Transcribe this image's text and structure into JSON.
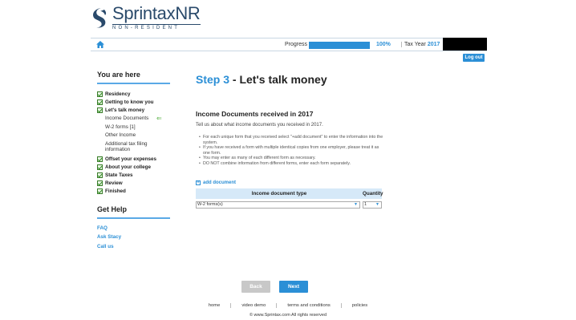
{
  "brand": {
    "name": "Sprintax",
    "name_suffix": "NR",
    "subtitle": "NON-RESIDENT"
  },
  "topbar": {
    "progress_label": "Progress",
    "progress_value": 1.0,
    "progress_pct": "100%",
    "tax_year_label": "Tax Year",
    "tax_year": "2017",
    "logout_label": "Log out"
  },
  "sidebar": {
    "title": "You are here",
    "steps": [
      {
        "label": "Residency",
        "checked": true
      },
      {
        "label": "Getting to know you",
        "checked": true
      },
      {
        "label": "Let's talk money",
        "checked": true
      }
    ],
    "substeps": [
      {
        "label": "Income Documents",
        "current": true
      },
      {
        "label": "W-2 forms [1]"
      },
      {
        "label": "Other Income"
      },
      {
        "label": "Additional tax filing information"
      }
    ],
    "steps_after": [
      {
        "label": "Offset your expenses",
        "checked": true
      },
      {
        "label": "About your college",
        "checked": true
      },
      {
        "label": "State Taxes",
        "checked": true
      },
      {
        "label": "Review",
        "checked": true
      },
      {
        "label": "Finished",
        "checked": true
      }
    ],
    "help_title": "Get Help",
    "help_links": [
      "FAQ",
      "Ask Stacy",
      "Call us"
    ]
  },
  "main": {
    "step_number": "Step 3",
    "step_title": "- Let's talk money",
    "section_title": "Income Documents received in 2017",
    "section_desc": "Tell us about what income documents you received in 2017.",
    "bullets": [
      "For each unique form that you received select \"+add document\" to enter the information into the system.",
      "If you have received a form with multiple identical copies from one employer, please treat it as one form.",
      "You may enter as many of each different form as necessary.",
      "DO NOT combine information from different forms, enter each form separately."
    ],
    "add_document": "add document",
    "table": {
      "col_type": "Income document type",
      "col_qty": "Quantity",
      "row_type": "W-2 forms(s)",
      "row_qty": "1"
    }
  },
  "buttons": {
    "back": "Back",
    "next": "Next"
  },
  "footer": {
    "links": [
      "home",
      "video demo",
      "terms and conditions",
      "policies"
    ],
    "copyright": "© www.Sprintax.com All rights reserved"
  },
  "colors": {
    "accent": "#2b8fd6",
    "brand": "#2a4a6b",
    "check": "#2b8a1d"
  }
}
